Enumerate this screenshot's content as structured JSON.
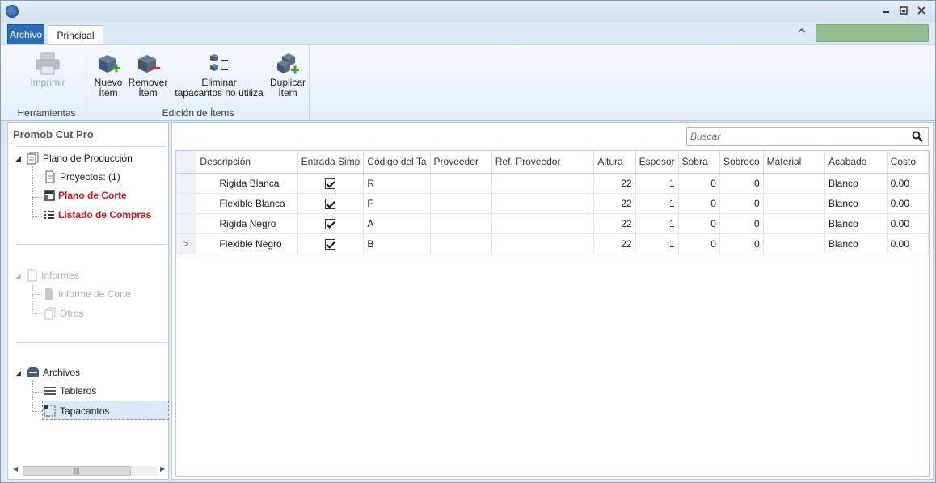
{
  "ribbon": {
    "tabs": {
      "archivo": "Archivo",
      "principal": "Principal"
    },
    "groups": {
      "herramientas": {
        "label": "Herramientas",
        "imprimir": "Imprimir"
      },
      "edicion": {
        "label": "Edición de Ítems",
        "nuevo_line1": "Nuevo",
        "nuevo_line2": "Ítem",
        "remover_line1": "Remover",
        "remover_line2": "Ítem",
        "eliminar_line1": "Eliminar",
        "eliminar_line2": "tapacantos no utiliza",
        "duplicar_line1": "Duplicar",
        "duplicar_line2": "Ítem"
      }
    }
  },
  "sidebar": {
    "title": "Promob Cut Pro",
    "plano": {
      "label": "Plano de Producción",
      "proyectos": "Proyectos: (1)",
      "plano_corte": "Plano de Corte",
      "listado": "Listado de Compras"
    },
    "informes": {
      "label": "Informes",
      "corte": "Informe de Corte",
      "otros": "Otros"
    },
    "archivos": {
      "label": "Archivos",
      "tableros": "Tableros",
      "tapacantos": "Tapacantos"
    }
  },
  "search": {
    "placeholder": "Buscar"
  },
  "grid": {
    "columns": [
      "Descripción",
      "Entrada Simp",
      "Código del Ta",
      "Proveedor",
      "Ref. Proveedor",
      "Altura",
      "Espesor",
      "Sobra",
      "Sobreco",
      "Material",
      "Acabado",
      "Costo"
    ],
    "rows": [
      {
        "descripcion": "Rigida Blanca",
        "entrada": true,
        "codigo": "R",
        "proveedor": "",
        "ref": "",
        "altura": "22",
        "espesor": "1",
        "sobra": "0",
        "sobreco": "0",
        "material": "",
        "acabado": "Blanco",
        "costo": "0.00"
      },
      {
        "descripcion": "Flexible Blanca",
        "entrada": true,
        "codigo": "F",
        "proveedor": "",
        "ref": "",
        "altura": "22",
        "espesor": "1",
        "sobra": "0",
        "sobreco": "0",
        "material": "",
        "acabado": "Blanco",
        "costo": "0.00"
      },
      {
        "descripcion": "Rigida Negro",
        "entrada": true,
        "codigo": "A",
        "proveedor": "",
        "ref": "",
        "altura": "22",
        "espesor": "1",
        "sobra": "0",
        "sobreco": "0",
        "material": "",
        "acabado": "Blanco",
        "costo": "0.00"
      },
      {
        "descripcion": "Flexible Negro",
        "entrada": true,
        "codigo": "B",
        "proveedor": "",
        "ref": "",
        "altura": "22",
        "espesor": "1",
        "sobra": "0",
        "sobreco": "0",
        "material": "",
        "acabado": "Blanco",
        "costo": "0.00"
      }
    ],
    "current_row_marker": ">"
  },
  "colors": {
    "archivo_tab": "#2b6cb7",
    "status_green": "#93bc8f",
    "red_link": "#e0101a"
  }
}
